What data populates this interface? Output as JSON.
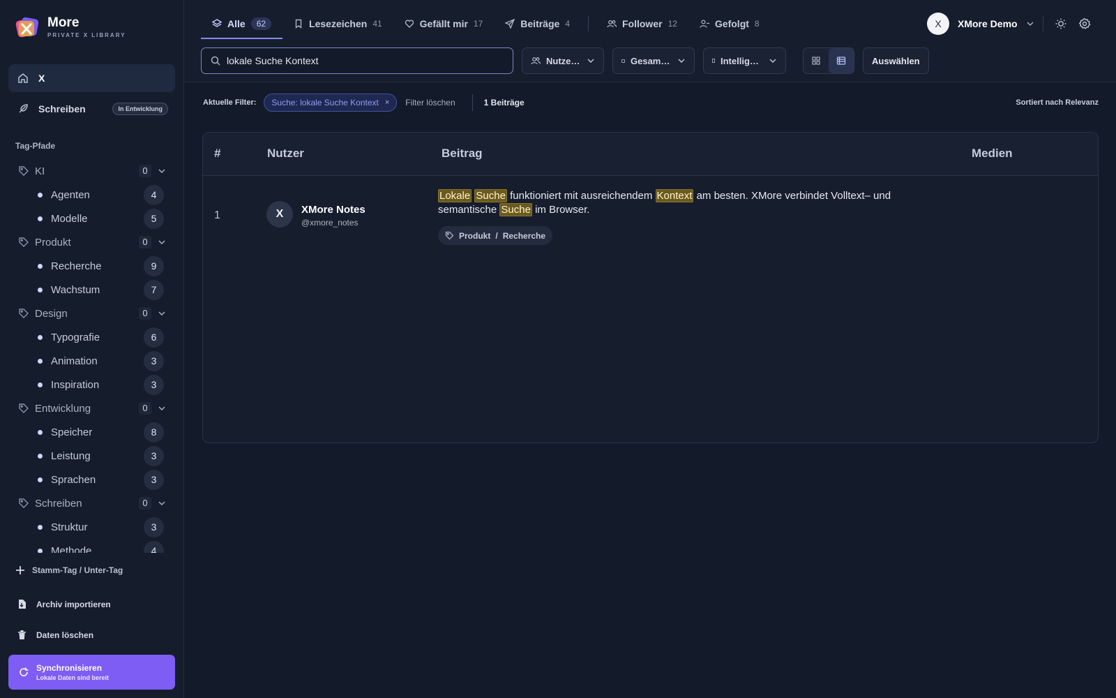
{
  "brand": {
    "name": "More",
    "subtitle": "PRIVATE X LIBRARY"
  },
  "nav": {
    "home_label": "X",
    "write_label": "Schreiben",
    "write_badge": "In Entwicklung"
  },
  "tags": {
    "section_label": "Tag-Pfade",
    "groups": [
      {
        "name": "KI",
        "count": "0",
        "children": [
          {
            "name": "Agenten",
            "count": "4"
          },
          {
            "name": "Modelle",
            "count": "5"
          }
        ]
      },
      {
        "name": "Produkt",
        "count": "0",
        "children": [
          {
            "name": "Recherche",
            "count": "9"
          },
          {
            "name": "Wachstum",
            "count": "7"
          }
        ]
      },
      {
        "name": "Design",
        "count": "0",
        "children": [
          {
            "name": "Typografie",
            "count": "6"
          },
          {
            "name": "Animation",
            "count": "3"
          },
          {
            "name": "Inspiration",
            "count": "3"
          }
        ]
      },
      {
        "name": "Entwicklung",
        "count": "0",
        "children": [
          {
            "name": "Speicher",
            "count": "8"
          },
          {
            "name": "Leistung",
            "count": "3"
          },
          {
            "name": "Sprachen",
            "count": "3"
          }
        ]
      },
      {
        "name": "Schreiben",
        "count": "0",
        "children": [
          {
            "name": "Struktur",
            "count": "3"
          },
          {
            "name": "Methode",
            "count": "4"
          }
        ]
      }
    ],
    "add_label": "Stamm-Tag / Unter-Tag"
  },
  "actions": {
    "import_label": "Archiv importieren",
    "delete_label": "Daten löschen",
    "sync_title": "Synchronisieren",
    "sync_subtitle": "Lokale Daten sind bereit"
  },
  "tabs": [
    {
      "label": "Alle",
      "count": "62",
      "icon": "layers-icon"
    },
    {
      "label": "Lesezeichen",
      "count": "41",
      "icon": "bookmark-icon"
    },
    {
      "label": "Gefällt mir",
      "count": "17",
      "icon": "heart-icon"
    },
    {
      "label": "Beiträge",
      "count": "4",
      "icon": "send-icon"
    },
    {
      "label": "Follower",
      "count": "12",
      "icon": "users-icon"
    },
    {
      "label": "Gefolgt",
      "count": "8",
      "icon": "user-check-icon"
    }
  ],
  "user": {
    "initial": "X",
    "name": "XMore Demo"
  },
  "search": {
    "value": "lokale Suche Kontext"
  },
  "toolbar": {
    "user_filter": "Nutze…",
    "range_filter": "Gesam…",
    "sort_filter": "Intellig…",
    "select_label": "Auswählen"
  },
  "filters": {
    "label": "Aktuelle Filter:",
    "chip": "Suche: lokale Suche Kontext",
    "chip_close": "×",
    "clear": "Filter löschen",
    "count": "1 Beiträge",
    "sort": "Sortiert nach Relevanz"
  },
  "table": {
    "headers": {
      "num": "#",
      "user": "Nutzer",
      "post": "Beitrag",
      "media": "Medien"
    },
    "rows": [
      {
        "num": "1",
        "avatar": "X",
        "name": "XMore Notes",
        "handle": "@xmore_notes",
        "segments": [
          {
            "text": "Lokale",
            "hl": true
          },
          {
            "text": " ",
            "hl": false
          },
          {
            "text": "Suche",
            "hl": true
          },
          {
            "text": " funktioniert mit ausreichendem ",
            "hl": false
          },
          {
            "text": "Kontext",
            "hl": true
          },
          {
            "text": " am besten. XMore verbindet Volltext– und semantische ",
            "hl": false
          },
          {
            "text": "Suche",
            "hl": true
          },
          {
            "text": " im Browser.",
            "hl": false
          }
        ],
        "tag_parent": "Produkt",
        "tag_sep": "/",
        "tag_child": "Recherche"
      }
    ]
  },
  "colors": {
    "accent": "#7d5df3",
    "highlight": "#6b5a1f",
    "background": "#131a2a"
  }
}
